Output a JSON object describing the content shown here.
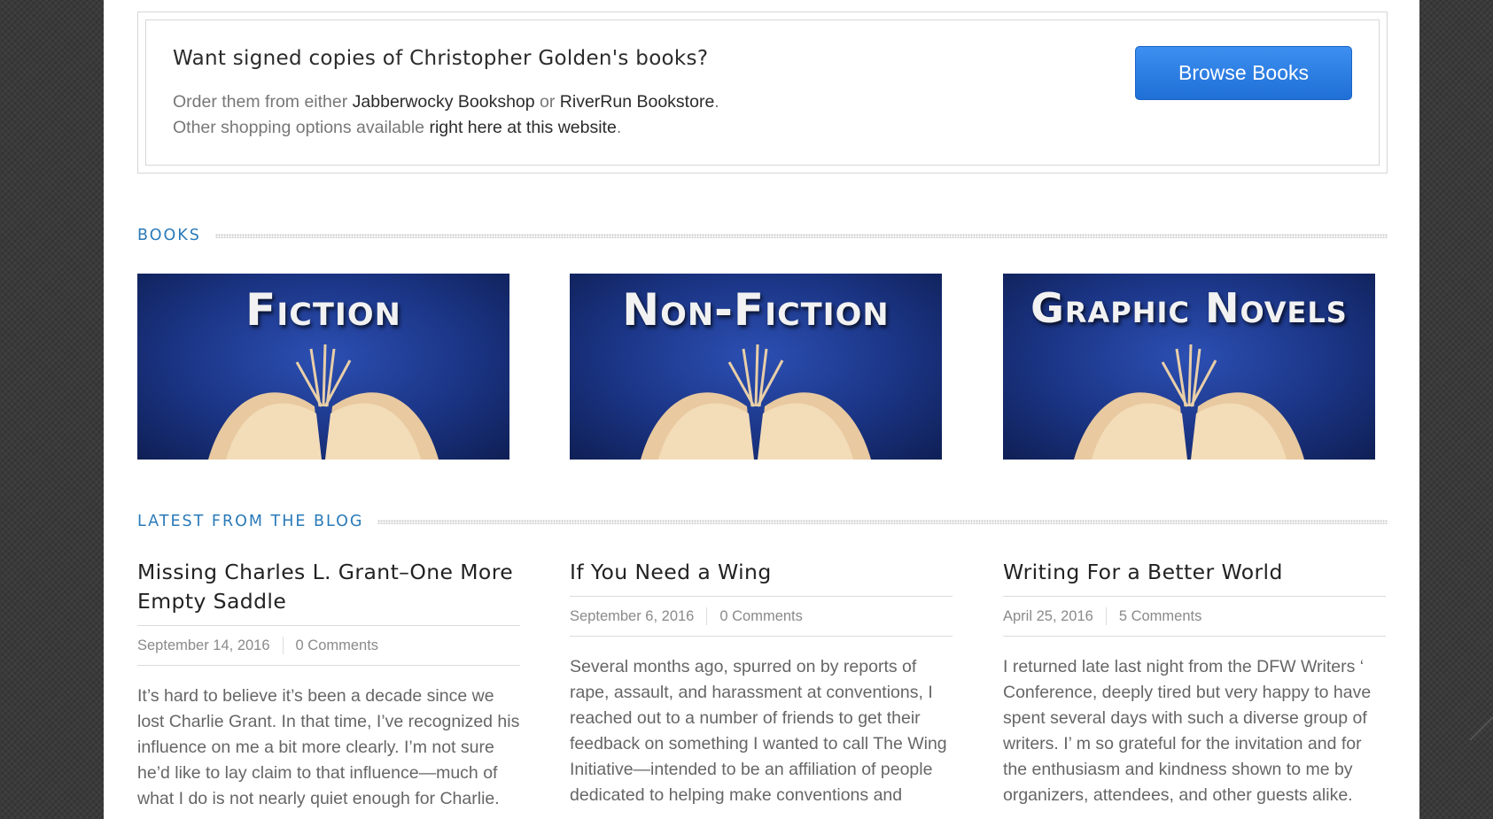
{
  "callout": {
    "title": "Want signed copies of Christopher Golden's books?",
    "line1_prefix": "Order them from either ",
    "link_jabberwocky": "Jabberwocky Bookshop",
    "line1_or": " or ",
    "link_riverrun": "RiverRun Bookstore",
    "line1_suffix": ".",
    "line2_prefix": "Other shopping options available ",
    "link_here": "right here at this website",
    "line2_suffix": ".",
    "button_label": "Browse Books",
    "button_color": "#2b7ae4"
  },
  "books_section": {
    "heading": "BOOKS",
    "tiles": [
      {
        "label": "Fiction"
      },
      {
        "label": "Non-Fiction"
      },
      {
        "label": "Graphic Novels"
      }
    ]
  },
  "blog_section": {
    "heading": "LATEST FROM THE BLOG",
    "posts": [
      {
        "title": "Missing Charles L. Grant–One More Empty Saddle",
        "date": "September 14, 2016",
        "comments": "0 Comments",
        "excerpt": "It’s hard to believe it’s been a decade since we lost Charlie Grant. In that time, I’ve recognized his influence on me a bit more clearly. I’m not sure he’d like to lay claim to that influence—much of what I do is not nearly quiet enough for Charlie."
      },
      {
        "title": "If You Need a Wing",
        "date": "September 6, 2016",
        "comments": "0 Comments",
        "excerpt": "Several months ago, spurred on by reports of rape, assault, and harassment at conventions, I reached out to a number of friends to get their feedback on something I wanted to call The Wing Initiative—intended to be an affiliation of people dedicated to helping make conventions and"
      },
      {
        "title": "Writing For a Better World",
        "date": "April 25, 2016",
        "comments": "5 Comments",
        "excerpt": "I returned late last night from the DFW Writers ‘ Conference, deeply tired but very happy to have spent several days with such a diverse group of writers. I’ m so grateful for the invitation and for the enthusiasm and kindness shown to me by organizers, attendees, and other guests alike."
      }
    ]
  },
  "colors": {
    "accent": "#2a7ab8",
    "tile_bg": "#1b3585",
    "page_bg": "#3a3a3a"
  }
}
